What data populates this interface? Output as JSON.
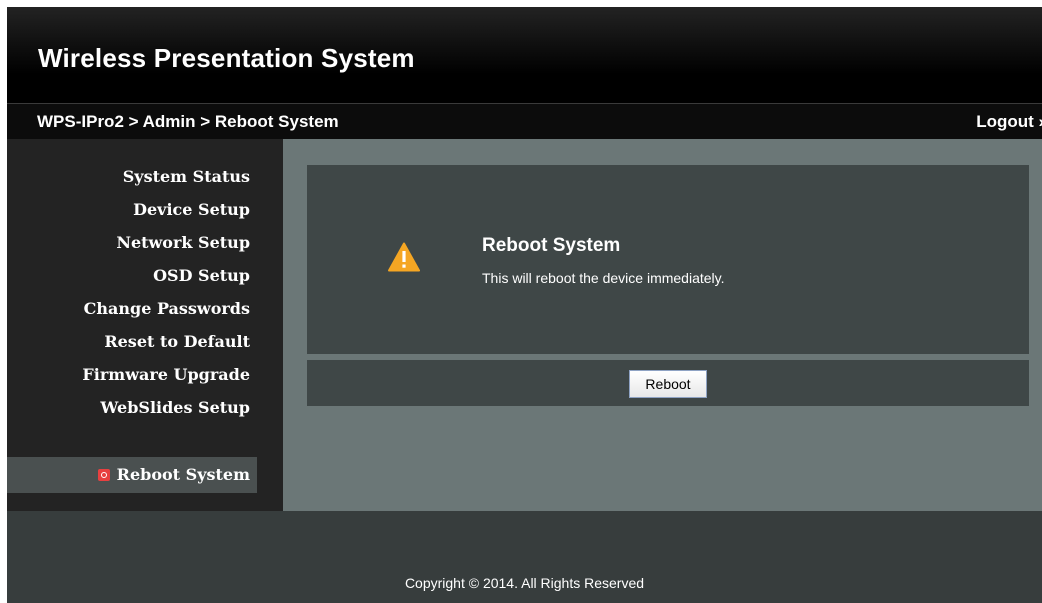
{
  "header": {
    "title": "Wireless Presentation System"
  },
  "topbar": {
    "breadcrumb": "WPS-IPro2 > Admin > Reboot System",
    "logout": "Logout »"
  },
  "sidebar": {
    "items": [
      {
        "label": "System Status"
      },
      {
        "label": "Device Setup"
      },
      {
        "label": "Network Setup"
      },
      {
        "label": "OSD Setup"
      },
      {
        "label": "Change Passwords"
      },
      {
        "label": "Reset to Default"
      },
      {
        "label": "Firmware Upgrade"
      },
      {
        "label": "WebSlides Setup"
      }
    ],
    "active_item": {
      "label": "Reboot System",
      "icon": "power-icon"
    }
  },
  "main": {
    "panel": {
      "icon": "warning-icon",
      "title": "Reboot System",
      "description": "This will reboot the device immediately."
    },
    "reboot_button_label": "Reboot"
  },
  "footer": {
    "copyright": "Copyright © 2014. All Rights Reserved"
  },
  "colors": {
    "header_bg": "#000000",
    "sidebar_bg": "#232323",
    "content_bg": "#6b7777",
    "panel_bg": "#3f4747",
    "footer_bg": "#373d3d",
    "warning": "#f5a623",
    "power_icon": "#e84040"
  }
}
